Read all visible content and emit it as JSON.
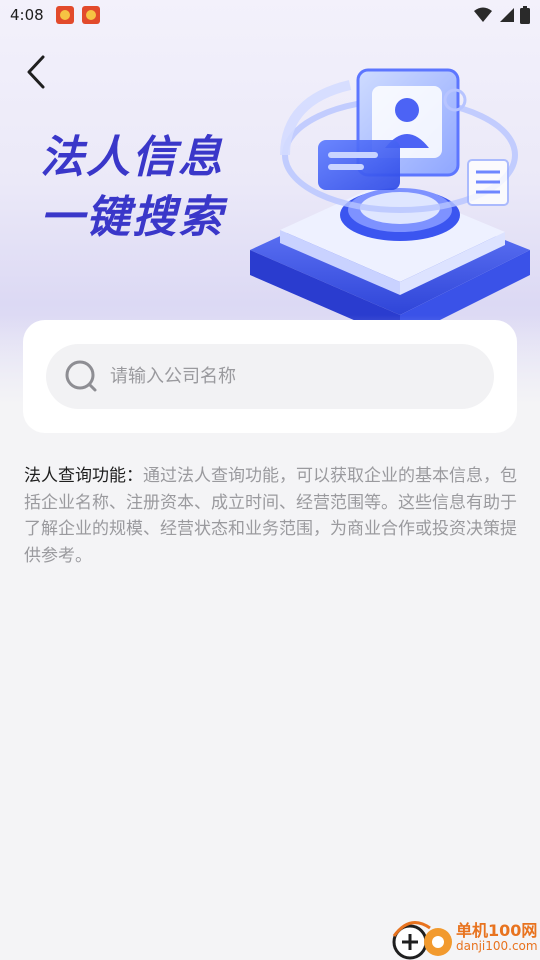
{
  "status_bar": {
    "time": "4:08"
  },
  "hero": {
    "title_line1": "法人信息",
    "title_line2": "一键搜索"
  },
  "search": {
    "placeholder": "请输入公司名称",
    "value": ""
  },
  "description": {
    "label": "法人查询功能：",
    "text": "通过法人查询功能，可以获取企业的基本信息，包括企业名称、注册资本、成立时间、经营范围等。这些信息有助于了解企业的规模、经营状态和业务范围，为商业合作或投资决策提供参考。"
  },
  "watermark": {
    "name": "单机100网",
    "url": "danji100.com"
  },
  "colors": {
    "title_blue": "#3a37c9",
    "accent_blue": "#4a6cf7",
    "page_bg": "#f4f4f6",
    "watermark_orange": "#e8731f"
  },
  "icons": {
    "back": "chevron-left-icon",
    "search": "search-icon",
    "wifi": "wifi-icon",
    "signal": "signal-icon",
    "battery": "battery-icon"
  }
}
